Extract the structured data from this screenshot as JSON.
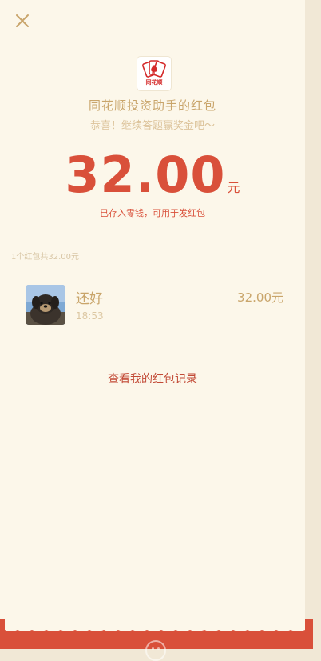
{
  "header": {
    "close_icon": "close-icon",
    "app_name": "同花顺投资助手的红包",
    "subtitle": "恭喜！继续答题赢奖金吧～",
    "logo_text": "同花顺"
  },
  "amount": {
    "value": "32.00",
    "unit": "元",
    "note": "已存入零钱，可用于发红包"
  },
  "summary": "1个红包共32.00元",
  "records": [
    {
      "name": "还好",
      "time": "18:53",
      "amount": "32.00元",
      "avatar_icon": "user-avatar"
    }
  ],
  "history_link": "查看我的红包记录",
  "colors": {
    "accent_red": "#d9503a",
    "gold": "#c9a56b",
    "sheet_bg": "#fcf7ea",
    "outer_bg": "#f1e8d6",
    "footer_red": "#d9503a"
  }
}
